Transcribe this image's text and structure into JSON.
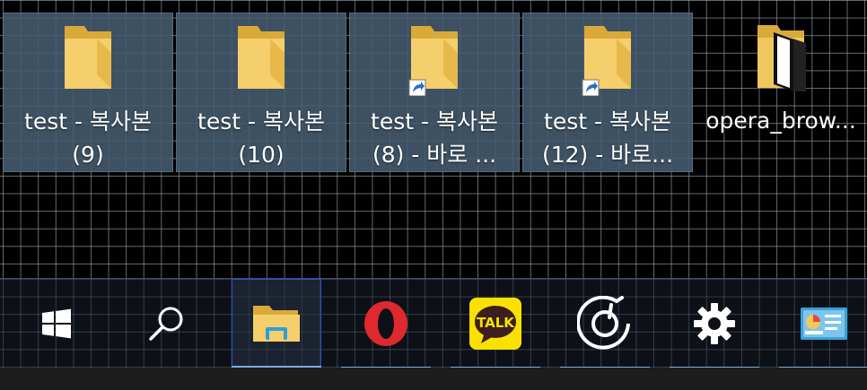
{
  "desktop": {
    "items": [
      {
        "line1": "test - 복사본",
        "line2": "(9)",
        "icon": "folder-icon",
        "selected": true
      },
      {
        "line1": "test - 복사본",
        "line2": "(10)",
        "icon": "folder-icon",
        "selected": true
      },
      {
        "line1": "test - 복사본",
        "line2": "(8) - 바로 ...",
        "icon": "folder-shortcut-icon",
        "selected": true
      },
      {
        "line1": "test - 복사본",
        "line2": "(12) - 바로...",
        "icon": "folder-shortcut-icon",
        "selected": true
      },
      {
        "line1": "opera_brow...",
        "line2": "",
        "icon": "opera-archive-icon",
        "selected": false
      }
    ]
  },
  "taskbar": {
    "items": [
      {
        "icon": "windows-start-icon"
      },
      {
        "icon": "search-icon"
      },
      {
        "icon": "file-explorer-icon",
        "active": true
      },
      {
        "icon": "opera-icon"
      },
      {
        "icon": "kakaotalk-icon",
        "text": "TALK"
      },
      {
        "icon": "groove-music-icon"
      },
      {
        "icon": "settings-gear-icon"
      },
      {
        "icon": "control-panel-icon"
      }
    ]
  },
  "colors": {
    "selection": "#465c70",
    "indicator": "#7aaee0",
    "active_border": "#3a4cd8",
    "folder": "#f0c75e",
    "opera_red": "#e0282f",
    "kakao_yellow": "#fae100"
  }
}
